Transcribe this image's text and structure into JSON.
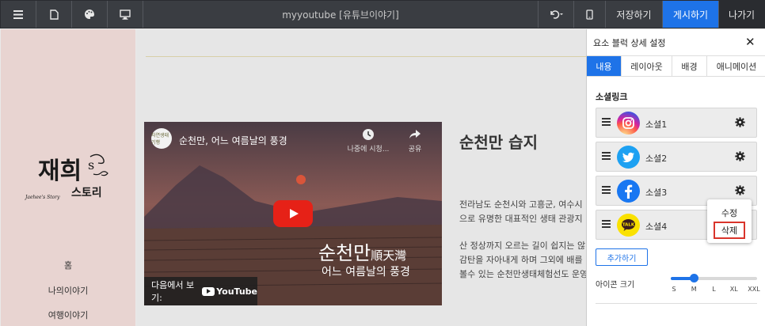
{
  "toolbar": {
    "title": "myyoutube [유튜브이야기]",
    "save_label": "저장하기",
    "publish_label": "게시하기",
    "exit_label": "나가기",
    "icons": [
      "menu-icon",
      "page-icon",
      "palette-icon",
      "monitor-icon",
      "undo-icon",
      "mobile-icon"
    ]
  },
  "site": {
    "logo_main": "재희s",
    "logo_sub": "스토리",
    "logo_script": "Jaehee's Story",
    "nav": [
      "홈",
      "나의이야기",
      "여행이야기"
    ]
  },
  "video": {
    "channel_badge": "자연생태기행",
    "title": "순천만, 어느 여름날의 풍경",
    "watch_later": "나중에 시청...",
    "share": "공유",
    "overlay_main": "순천만",
    "overlay_hanja": "順天灣",
    "overlay_sub": "어느 여름날의 풍경",
    "watch_on": "다음에서 보기:",
    "brand": "YouTube"
  },
  "article": {
    "title": "순천만 습지",
    "paragraph1": [
      "전라남도 순천시와 고흥군, 여수시",
      "으로 유명한 대표적인 생태 관광지"
    ],
    "paragraph2": [
      "산 정상까지 오르는 길이 쉽지는 않",
      "감탄을 자아내게 하며 그외에 배를",
      "볼수 있는 순천만생태체험선도 운영"
    ]
  },
  "panel": {
    "title": "요소 블럭 상세 설정",
    "tabs": [
      "내용",
      "레이아웃",
      "배경",
      "애니메이션"
    ],
    "active_tab": 0,
    "section_label": "소셜링크",
    "socials": [
      {
        "label": "소셜1",
        "icon": "instagram-icon",
        "color": "#d6249f"
      },
      {
        "label": "소셜2",
        "icon": "twitter-icon",
        "color": "#1da1f2"
      },
      {
        "label": "소셜3",
        "icon": "facebook-icon",
        "color": "#1877f2"
      },
      {
        "label": "소셜4",
        "icon": "kakaotalk-icon",
        "color": "#fae100"
      }
    ],
    "context_menu": {
      "edit": "수정",
      "delete": "삭제"
    },
    "add_button": "추가하기",
    "icon_size_label": "아이콘 크기",
    "sizes": [
      "S",
      "M",
      "L",
      "XL",
      "XXL"
    ],
    "selected_size": "M",
    "accent_color": "#1e73e8"
  }
}
